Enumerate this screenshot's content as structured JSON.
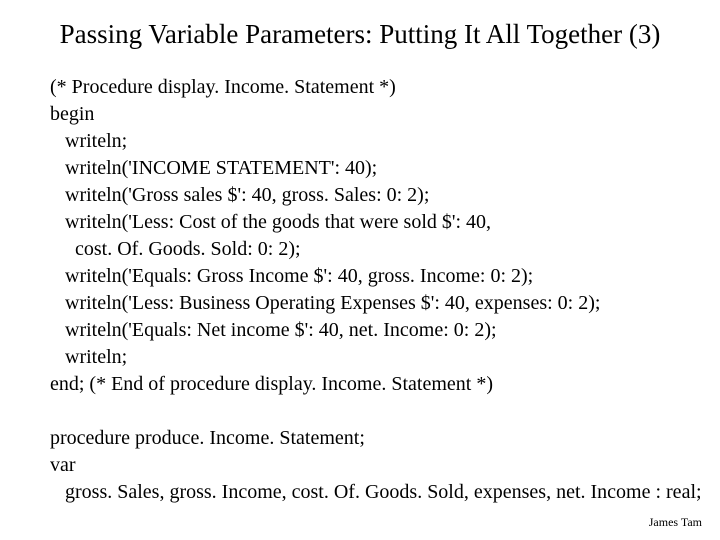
{
  "title": "Passing Variable Parameters: Putting It All Together (3)",
  "code": "(* Procedure display. Income. Statement *)\nbegin\n   writeln;\n   writeln('INCOME STATEMENT': 40);\n   writeln('Gross sales $': 40, gross. Sales: 0: 2);\n   writeln('Less: Cost of the goods that were sold $': 40,\n     cost. Of. Goods. Sold: 0: 2);\n   writeln('Equals: Gross Income $': 40, gross. Income: 0: 2);\n   writeln('Less: Business Operating Expenses $': 40, expenses: 0: 2);\n   writeln('Equals: Net income $': 40, net. Income: 0: 2);\n   writeln;\nend; (* End of procedure display. Income. Statement *)\n\nprocedure produce. Income. Statement;\nvar\n   gross. Sales, gross. Income, cost. Of. Goods. Sold, expenses, net. Income : real;",
  "footer": "James Tam"
}
